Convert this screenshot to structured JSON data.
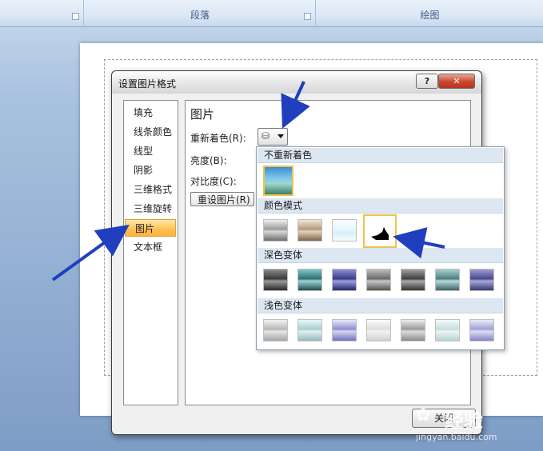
{
  "ribbon": {
    "group_paragraph": "段落",
    "group_drawing": "绘图"
  },
  "dialog": {
    "title": "设置图片格式",
    "help_label": "?",
    "close_x": "✕",
    "nav": [
      "填充",
      "线条颜色",
      "线型",
      "阴影",
      "三维格式",
      "三维旋转",
      "图片",
      "文本框"
    ],
    "selected_nav": "图片",
    "panel_heading": "图片",
    "recolor_label": "重新着色(R):",
    "brightness_label": "亮度(B):",
    "contrast_label": "对比度(C):",
    "reset_label": "重设图片(R)",
    "close_label": "关闭"
  },
  "dropdown": {
    "no_recolor": "不重新着色",
    "color_modes": "颜色模式",
    "dark_variants": "深色变体",
    "light_variants": "浅色变体"
  },
  "watermark": {
    "text": "经验",
    "url": "jingyan.baidu.com"
  },
  "colors": {
    "accent_blue": "#1f3fbf",
    "selection": "#ffc35a"
  }
}
